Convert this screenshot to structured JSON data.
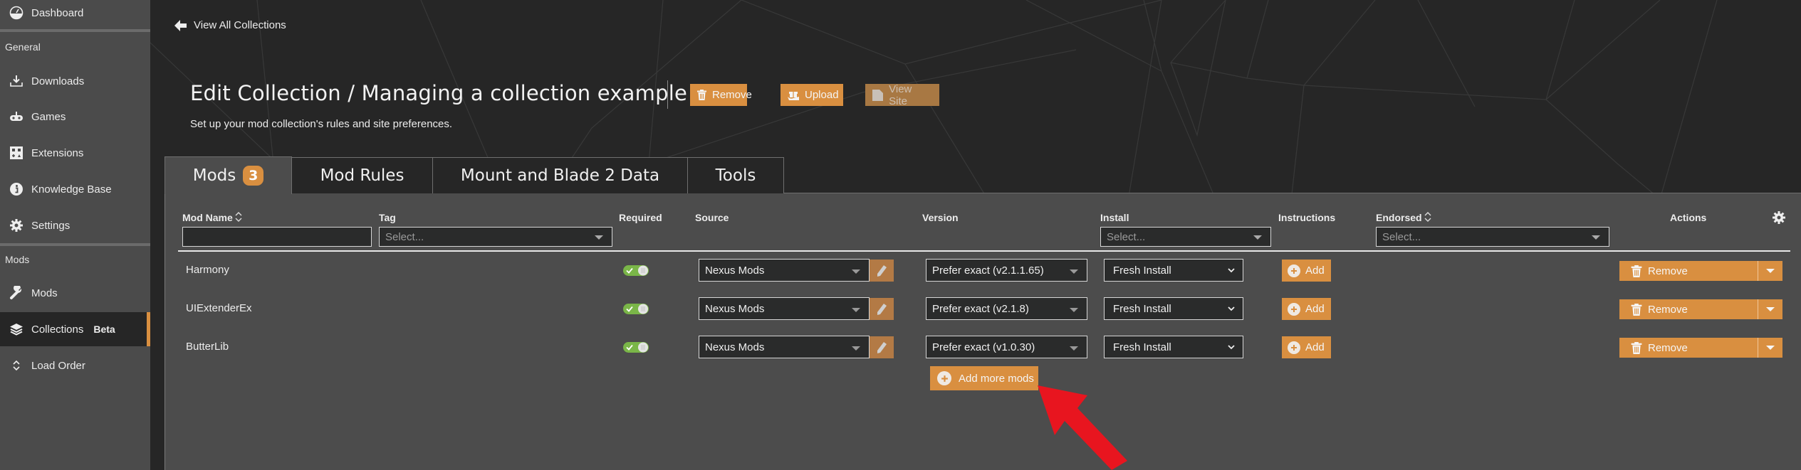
{
  "sidebar": {
    "items": [
      {
        "label": "Dashboard",
        "icon": "dashboard-icon"
      },
      {
        "label": "Downloads",
        "icon": "download-icon"
      },
      {
        "label": "Games",
        "icon": "gamepad-icon"
      },
      {
        "label": "Extensions",
        "icon": "extensions-icon"
      },
      {
        "label": "Knowledge Base",
        "icon": "info-icon"
      },
      {
        "label": "Settings",
        "icon": "gear-icon"
      },
      {
        "label": "Mods",
        "icon": "wrench-icon"
      },
      {
        "label": "Collections",
        "icon": "layers-icon",
        "badge": "Beta",
        "active": true
      },
      {
        "label": "Load Order",
        "icon": "sort-icon"
      }
    ],
    "sections": {
      "general": "General",
      "mods": "Mods"
    }
  },
  "header": {
    "back_label": "View All Collections",
    "title": "Edit Collection / Managing a collection example",
    "subtitle": "Set up your mod collection's rules and site preferences.",
    "buttons": {
      "remove": "Remove",
      "upload": "Upload",
      "view_site": "View Site"
    }
  },
  "tabs": [
    {
      "label": "Mods",
      "count": "3",
      "active": true
    },
    {
      "label": "Mod Rules"
    },
    {
      "label": "Mount and Blade 2 Data"
    },
    {
      "label": "Tools"
    }
  ],
  "table": {
    "columns": {
      "mod_name": "Mod Name",
      "tag": "Tag",
      "required": "Required",
      "source": "Source",
      "version": "Version",
      "install": "Install",
      "instructions": "Instructions",
      "endorsed": "Endorsed",
      "actions": "Actions"
    },
    "filters": {
      "mod_name_value": "",
      "tag_placeholder": "Select...",
      "install_placeholder": "Select...",
      "endorsed_placeholder": "Select..."
    },
    "rows": [
      {
        "name": "Harmony",
        "required": true,
        "source": "Nexus Mods",
        "version": "Prefer exact (v2.1.1.65)",
        "install": "Fresh Install",
        "instructions_button": "Add",
        "action": "Remove"
      },
      {
        "name": "UIExtenderEx",
        "required": true,
        "source": "Nexus Mods",
        "version": "Prefer exact (v2.1.8)",
        "install": "Fresh Install",
        "instructions_button": "Add",
        "action": "Remove"
      },
      {
        "name": "ButterLib",
        "required": true,
        "source": "Nexus Mods",
        "version": "Prefer exact (v1.0.30)",
        "install": "Fresh Install",
        "instructions_button": "Add",
        "action": "Remove"
      }
    ],
    "add_more_label": "Add more mods"
  },
  "colors": {
    "accent": "#d98f40",
    "sidebar_bg": "#4b4b4b",
    "panel_bg": "#4c4c4c",
    "page_bg": "#262626",
    "toggle_on": "#7ab648",
    "annotation_arrow": "#e8151f"
  }
}
